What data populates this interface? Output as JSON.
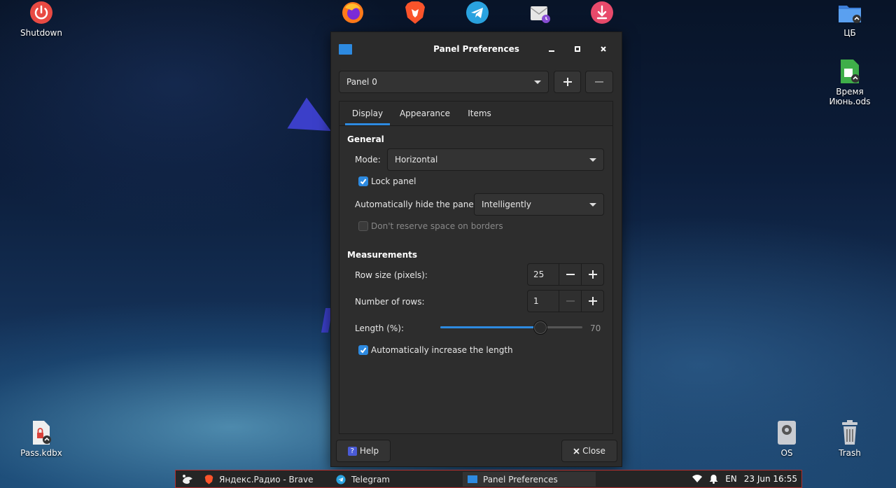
{
  "desktop": {
    "icons": [
      {
        "label": "Shutdown"
      },
      {
        "label": "ЦБ"
      },
      {
        "label": "Время\nИюнь.ods",
        "line1": "Время",
        "line2": "Июнь.ods"
      },
      {
        "label": "Pass.kdbx"
      },
      {
        "label": "OS"
      },
      {
        "label": "Trash"
      }
    ],
    "launchers": [
      "firefox-icon",
      "brave-icon",
      "telegram-icon",
      "mail-icon",
      "download-icon"
    ]
  },
  "window": {
    "title": "Panel Preferences",
    "panel_select": "Panel 0",
    "tabs": [
      "Display",
      "Appearance",
      "Items"
    ],
    "active_tab": "Display",
    "general": {
      "heading": "General",
      "mode_label": "Mode:",
      "mode_value": "Horizontal",
      "lock_panel_label": "Lock panel",
      "lock_panel_checked": true,
      "autohide_label": "Automatically hide the panel:",
      "autohide_value": "Intelligently",
      "reserve_label": "Don't reserve space on borders",
      "reserve_checked": false
    },
    "measurements": {
      "heading": "Measurements",
      "row_size_label": "Row size (pixels):",
      "row_size_value": "25",
      "rows_label": "Number of rows:",
      "rows_value": "1",
      "length_label": "Length (%):",
      "length_value": "70",
      "auto_length_label": "Automatically increase the length",
      "auto_length_checked": true
    },
    "help_label": "Help",
    "close_label": "Close"
  },
  "taskbar": {
    "tasks": [
      {
        "label": "Яндекс.Радио - Brave",
        "icon": "brave-icon"
      },
      {
        "label": "Telegram",
        "icon": "telegram-icon"
      },
      {
        "label": "Panel Preferences",
        "icon": "window-icon"
      }
    ],
    "language": "EN",
    "clock": "23 Jun 16:55"
  },
  "colors": {
    "accent": "#2d8ae0",
    "taskbar_border": "#b12f2f"
  }
}
